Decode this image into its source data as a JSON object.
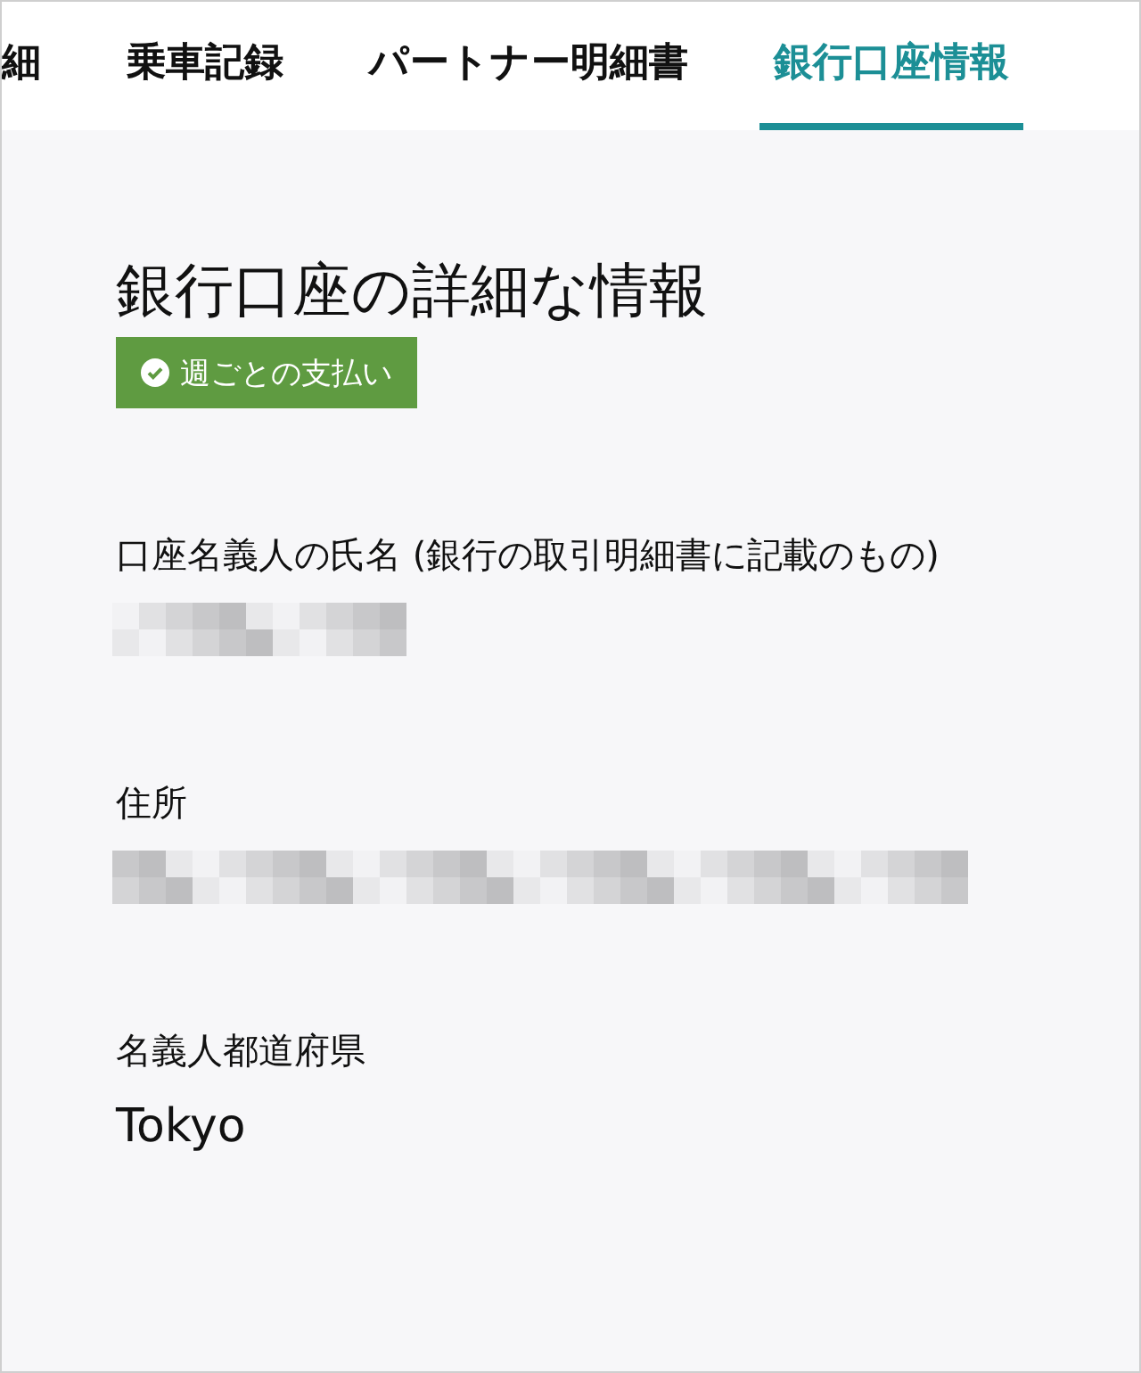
{
  "tabs": [
    {
      "label": "細",
      "selected": false
    },
    {
      "label": "乗車記録",
      "selected": false
    },
    {
      "label": "パートナー明細書",
      "selected": false
    },
    {
      "label": "銀行口座情報",
      "selected": true
    }
  ],
  "title": "銀行口座の詳細な情報",
  "badge": {
    "label": "週ごとの支払い"
  },
  "fields": [
    {
      "label": "口座名義人の氏名 (銀行の取引明細書に記載のもの)",
      "kind": "redacted"
    },
    {
      "label": "住所",
      "kind": "redacted"
    },
    {
      "label": "名義人都道府県",
      "kind": "text",
      "value": "Tokyo"
    }
  ]
}
